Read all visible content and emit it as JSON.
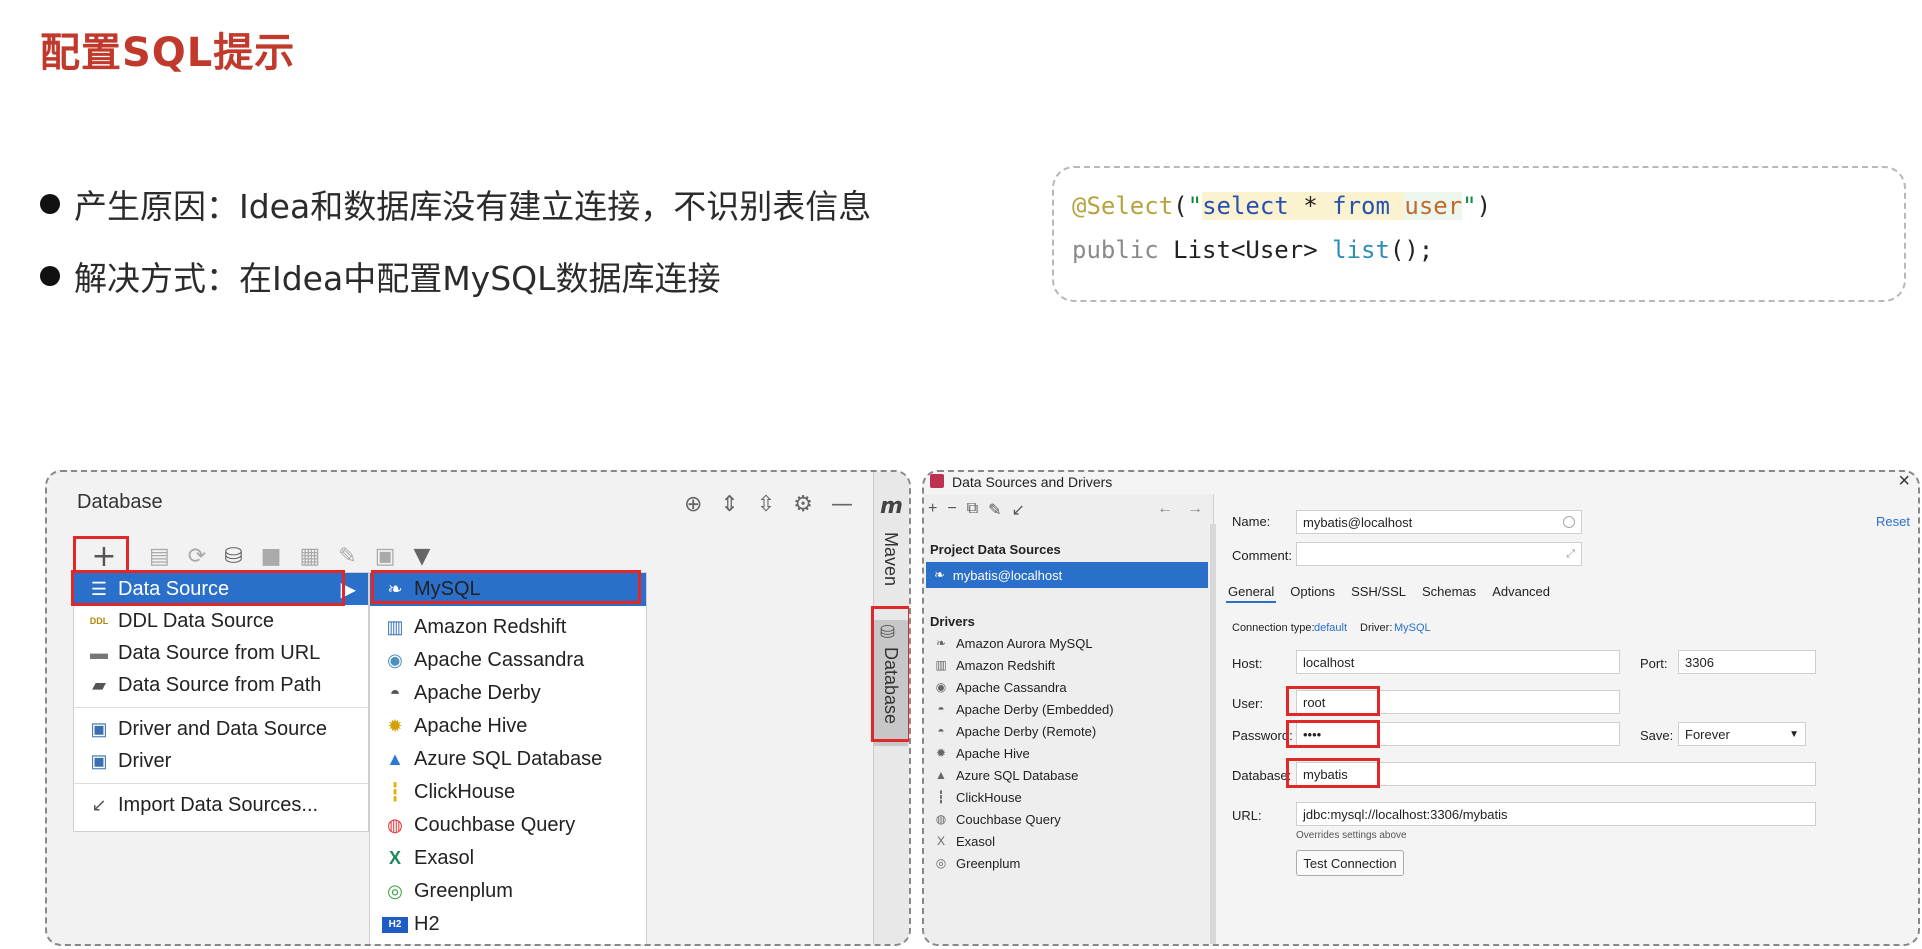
{
  "page": {
    "title": "配置SQL提示",
    "bullets": [
      "产生原因：Idea和数据库没有建立连接，不识别表信息",
      "解决方式：在Idea中配置MySQL数据库连接"
    ]
  },
  "code": {
    "line1_annotation": "@Select",
    "line1_paren_open": "(",
    "line1_quote_open": "\"",
    "line1_select": "select",
    "line1_star": " * ",
    "line1_from": "from",
    "line1_space": " ",
    "line1_table": "user",
    "line1_quote_close": "\"",
    "line1_paren_close": ")",
    "line2_public": "public",
    "line2_type": " List<User> ",
    "line2_method": "list",
    "line2_tail": "();"
  },
  "ide": {
    "panel_title": "Database",
    "side_tab_maven": "Maven",
    "side_tab_database": "Database",
    "maven_logo": "m",
    "plus_label": "+",
    "menu": [
      {
        "label": "Data Source",
        "icon": "stack-icon"
      },
      {
        "label": "DDL Data Source",
        "icon": "ddl-icon"
      },
      {
        "label": "Data Source from URL",
        "icon": "url-icon"
      },
      {
        "label": "Data Source from Path",
        "icon": "folder-icon"
      },
      {
        "label": "Driver and Data Source",
        "icon": "driver-icon"
      },
      {
        "label": "Driver",
        "icon": "driver-icon"
      },
      {
        "label": "Import Data Sources...",
        "icon": "import-icon"
      }
    ],
    "submenu": [
      "MySQL",
      "Amazon Redshift",
      "Apache Cassandra",
      "Apache Derby",
      "Apache Hive",
      "Azure SQL Database",
      "ClickHouse",
      "Couchbase Query",
      "Exasol",
      "Greenplum",
      "H2"
    ],
    "ddl_badge": "DDL",
    "h2_badge": "H2"
  },
  "dialog": {
    "title": "Data Sources and Drivers",
    "project_header": "Project Data Sources",
    "selected_source": "mybatis@localhost",
    "drivers_header": "Drivers",
    "drivers": [
      "Amazon Aurora MySQL",
      "Amazon Redshift",
      "Apache Cassandra",
      "Apache Derby (Embedded)",
      "Apache Derby (Remote)",
      "Apache Hive",
      "Azure SQL Database",
      "ClickHouse",
      "Couchbase Query",
      "Exasol",
      "Greenplum"
    ],
    "name_label": "Name:",
    "name_value": "mybatis@localhost",
    "reset": "Reset",
    "comment_label": "Comment:",
    "tabs": [
      "General",
      "Options",
      "SSH/SSL",
      "Schemas",
      "Advanced"
    ],
    "conn_type_label": "Connection type:",
    "conn_type_value": "default",
    "driver_label": "Driver:",
    "driver_value": "MySQL",
    "host_label": "Host:",
    "host_value": "localhost",
    "port_label": "Port:",
    "port_value": "3306",
    "user_label": "User:",
    "user_value": "root",
    "password_label": "Password:",
    "password_value": "••••",
    "save_label": "Save:",
    "save_value": "Forever",
    "database_label": "Database:",
    "database_value": "mybatis",
    "url_label": "URL:",
    "url_value": "jdbc:mysql://localhost:3306/mybatis",
    "url_hint": "Overrides settings above",
    "test_button": "Test Connection"
  }
}
